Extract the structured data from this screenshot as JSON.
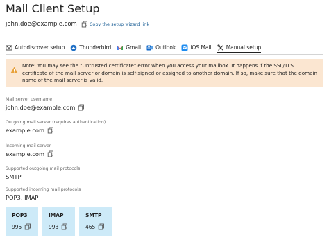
{
  "page": {
    "title": "Mail Client Setup",
    "email": "john.doe@example.com",
    "copy_link_label": "Copy the setup wizard link"
  },
  "tabs": [
    {
      "label": "Autodiscover setup",
      "icon": "envelope-icon"
    },
    {
      "label": "Thunderbird",
      "icon": "thunderbird-icon"
    },
    {
      "label": "Gmail",
      "icon": "gmail-icon"
    },
    {
      "label": "Outlook",
      "icon": "outlook-icon"
    },
    {
      "label": "iOS Mail",
      "icon": "ios-mail-icon"
    },
    {
      "label": "Manual setup",
      "icon": "tools-icon",
      "active": true
    }
  ],
  "notice": {
    "icon": "warning-icon",
    "text": "Note: You may see the \"Untrusted certificate\" error when you access your mailbox. It happens if the SSL/TLS certificate of the mail server or domain is self-signed or assigned to another domain. If so, make sure that the domain name of the mail server is valid."
  },
  "fields": {
    "username": {
      "label": "Mail server username",
      "value": "john.doe@example.com"
    },
    "outgoing": {
      "label": "Outgoing mail server (requires authentication)",
      "value": "example.com"
    },
    "incoming": {
      "label": "Incoming mail server",
      "value": "example.com"
    },
    "out_protocols": {
      "label": "Supported outgoing mail protocols",
      "value": "SMTP"
    },
    "in_protocols": {
      "label": "Supported incoming mail protocols",
      "value": "POP3, IMAP"
    }
  },
  "ports": [
    {
      "protocol": "POP3",
      "port": "995"
    },
    {
      "protocol": "IMAP",
      "port": "993"
    },
    {
      "protocol": "SMTP",
      "port": "465"
    }
  ],
  "colors": {
    "link": "#1c5f96",
    "notice_bg": "#fbe6d1",
    "warning": "#e8a13a",
    "card_bg": "#cdeaf8"
  }
}
